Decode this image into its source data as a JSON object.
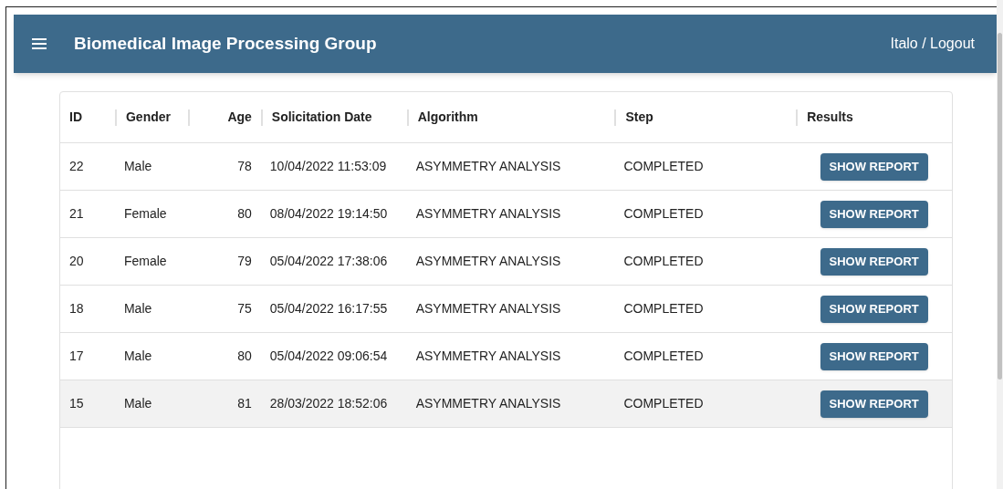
{
  "app_bar": {
    "title": "Biomedical Image Processing Group",
    "user_link": "Italo / Logout"
  },
  "table": {
    "columns": [
      "ID",
      "Gender",
      "Age",
      "Solicitation Date",
      "Algorithm",
      "Step",
      "Results"
    ],
    "rows": [
      {
        "id": "22",
        "gender": "Male",
        "age": "78",
        "date": "10/04/2022 11:53:09",
        "algorithm": "ASYMMETRY ANALYSIS",
        "step": "COMPLETED",
        "action": "SHOW REPORT",
        "selected": false
      },
      {
        "id": "21",
        "gender": "Female",
        "age": "80",
        "date": "08/04/2022 19:14:50",
        "algorithm": "ASYMMETRY ANALYSIS",
        "step": "COMPLETED",
        "action": "SHOW REPORT",
        "selected": false
      },
      {
        "id": "20",
        "gender": "Female",
        "age": "79",
        "date": "05/04/2022 17:38:06",
        "algorithm": "ASYMMETRY ANALYSIS",
        "step": "COMPLETED",
        "action": "SHOW REPORT",
        "selected": false
      },
      {
        "id": "18",
        "gender": "Male",
        "age": "75",
        "date": "05/04/2022 16:17:55",
        "algorithm": "ASYMMETRY ANALYSIS",
        "step": "COMPLETED",
        "action": "SHOW REPORT",
        "selected": false
      },
      {
        "id": "17",
        "gender": "Male",
        "age": "80",
        "date": "05/04/2022 09:06:54",
        "algorithm": "ASYMMETRY ANALYSIS",
        "step": "COMPLETED",
        "action": "SHOW REPORT",
        "selected": false
      },
      {
        "id": "15",
        "gender": "Male",
        "age": "81",
        "date": "28/03/2022 18:52:06",
        "algorithm": "ASYMMETRY ANALYSIS",
        "step": "COMPLETED",
        "action": "SHOW REPORT",
        "selected": true
      }
    ]
  }
}
